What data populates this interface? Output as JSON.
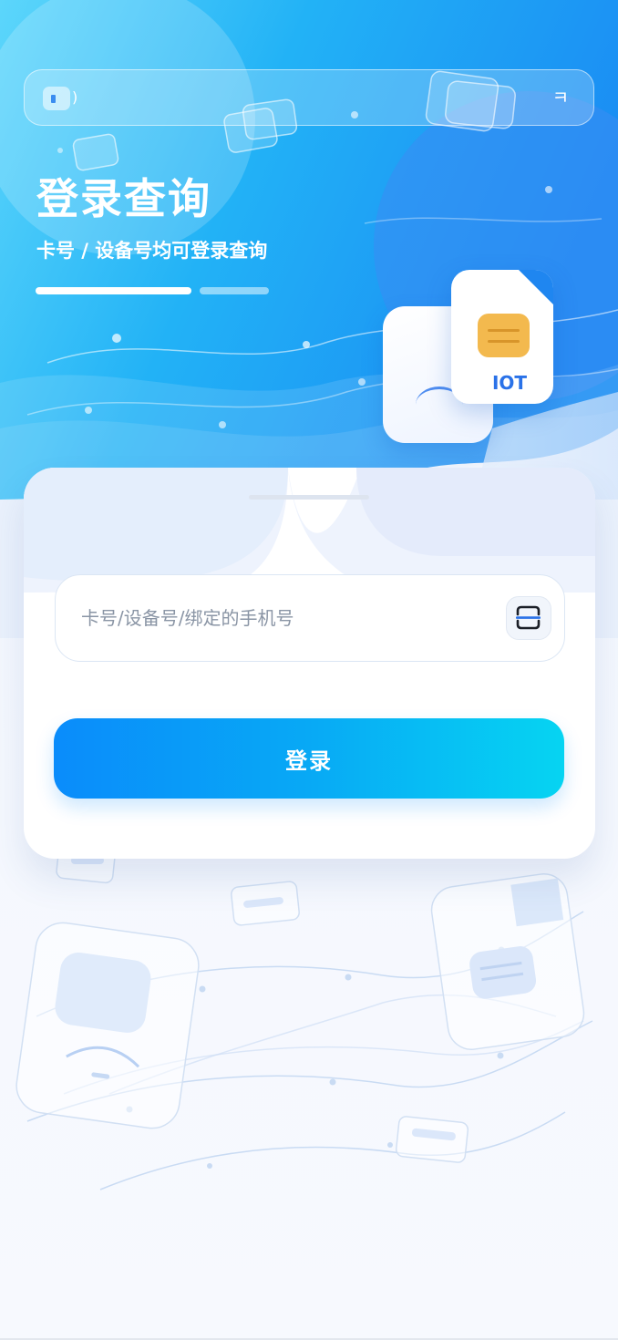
{
  "page": {
    "title": "登录查询",
    "subtitle": "卡号 / 设备号均可登录查询"
  },
  "topbar": {
    "left_icon": "signal-icon",
    "left_mark": ")",
    "right_icon": "menu-hook-icon",
    "right_mark": "ㅋ"
  },
  "illustration": {
    "card_label": "IOT",
    "icons": [
      "sim-card-icon",
      "chip-icon"
    ]
  },
  "form": {
    "account": {
      "placeholder": "卡号/设备号/绑定的手机号",
      "value": ""
    },
    "scan_icon": "scan-icon",
    "login_label": "登录"
  },
  "colors": {
    "hero_start": "#5dd3fb",
    "hero_end": "#1b8df3",
    "button_start": "#0a8cfb",
    "button_end": "#06d4f2",
    "chip": "#f3b94e",
    "iot_label": "#2a72e8"
  }
}
